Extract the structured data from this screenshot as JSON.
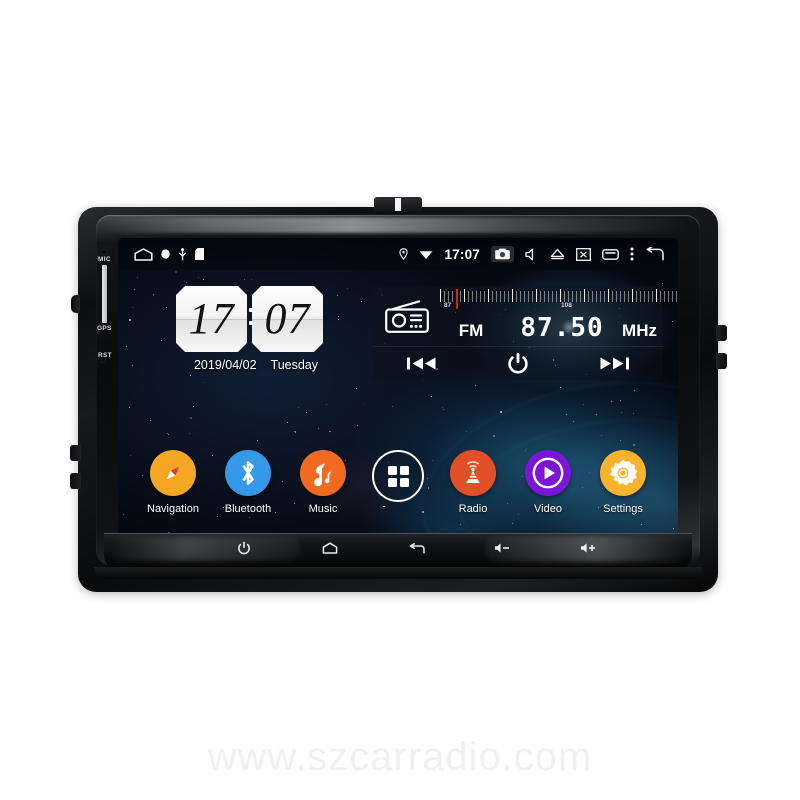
{
  "watermark": "www.szcarradio.com",
  "device": {
    "edge_labels": [
      {
        "name": "mic",
        "text": "MIC"
      },
      {
        "name": "gps",
        "text": "GPS"
      },
      {
        "name": "reset",
        "text": "RST"
      }
    ],
    "hw_buttons": [
      {
        "name": "power",
        "icon": "power-icon"
      },
      {
        "name": "home",
        "icon": "home-icon"
      },
      {
        "name": "back",
        "icon": "back-icon"
      },
      {
        "name": "volume-down",
        "icon": "volume-down-icon"
      },
      {
        "name": "volume-up",
        "icon": "volume-up-icon"
      }
    ]
  },
  "statusbar": {
    "left_icons": [
      "home-icon",
      "location-dot-icon",
      "usb-icon",
      "sd-card-icon"
    ],
    "clock": "17:07",
    "right_icons": [
      "gps-pin-icon",
      "wifi-icon",
      "camera-icon",
      "mute-icon",
      "eject-icon",
      "screen-off-icon",
      "recents-icon",
      "overflow-menu-icon",
      "back-icon"
    ]
  },
  "clock_widget": {
    "hours": "17",
    "minutes": "07",
    "date": "2019/04/02",
    "weekday": "Tuesday"
  },
  "radio_widget": {
    "icon": "radio-icon",
    "band": "FM",
    "frequency": "87.50",
    "unit": "MHz",
    "scale_min": "87",
    "scale_max": "108",
    "controls": [
      {
        "name": "previous-station",
        "icon": "skip-back-icon"
      },
      {
        "name": "radio-power",
        "icon": "power-icon"
      },
      {
        "name": "next-station",
        "icon": "skip-forward-icon"
      }
    ]
  },
  "apps": [
    {
      "label": "Navigation",
      "icon": "compass-icon",
      "color": "#f5a623"
    },
    {
      "label": "Bluetooth",
      "icon": "bluetooth-icon",
      "color": "#3399e8"
    },
    {
      "label": "Music",
      "icon": "music-note-icon",
      "color": "#f26a21"
    },
    {
      "label": "",
      "icon": "app-drawer-icon",
      "color": "transparent"
    },
    {
      "label": "Radio",
      "icon": "radio-tower-icon",
      "color": "#e2502a"
    },
    {
      "label": "Video",
      "icon": "play-icon",
      "color": "#7b16d9"
    },
    {
      "label": "Settings",
      "icon": "gear-icon",
      "color": "#f7b32b"
    }
  ]
}
